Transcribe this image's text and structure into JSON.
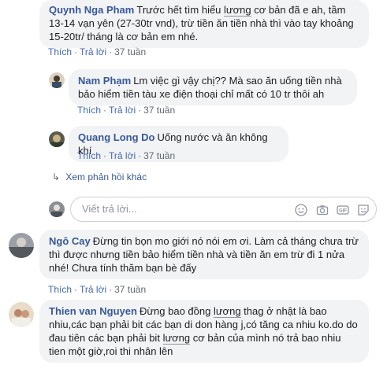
{
  "comments": [
    {
      "author": "Quynh Nga Pham",
      "text_lines": [
        [
          "Trước hết tìm hiểu ",
          {
            "hl": "lương"
          },
          " cơ bản đã e ah, tầm"
        ],
        [
          "13-14 vạn yên (27-30tr vnd), trừ tiền ăn tiền nhà thì vào tay khoảng"
        ],
        [
          "15-20tr/ tháng là cơ bản em nhé."
        ]
      ],
      "like": "Thích",
      "reply": "Trả lời",
      "time": "37 tuần"
    },
    {
      "author": "Nam Phạm",
      "text_lines": [
        [
          "Lm việc gì vậy chị?? Mà sao ăn uống tiền nhà"
        ],
        [
          "bảo hiểm tiền tàu xe điện thoại chỉ mất có 10 tr thôi ah"
        ]
      ],
      "like": "Thích",
      "reply": "Trả lời",
      "time": "37 tuần"
    },
    {
      "author": "Quang Long Do",
      "text_lines": [
        [
          "Uống nước và ăn không khí"
        ]
      ],
      "like": "Thích",
      "reply": "Trả lời",
      "time": "37 tuần"
    },
    {
      "author": "Ngô Cay",
      "text_lines": [
        [
          "Đừng tin bọn mo giới nó nói em ơi. Làm cả tháng chưa trừ"
        ],
        [
          "thì được nhưng tiền bảo hiểm tiền nhà và tiền ăn em trừ đi 1 nửa"
        ],
        [
          "nhé! Chưa tính thăm bạn bè đấy"
        ]
      ],
      "like": "Thích",
      "reply": "Trả lời",
      "time": "37 tuần"
    },
    {
      "author": "Thien van Nguyen",
      "text_lines": [
        [
          "Đừng bao đồng ",
          {
            "hl": "lương"
          },
          " thag ở nhật là bao"
        ],
        [
          "nhiu,các bạn phải bit các bạn di don hàng j,có tăng ca nhiu ko.do do"
        ],
        [
          "đau tiên các bạn phải bit ",
          {
            "hl": "lương"
          },
          " cơ bản của mình nó trả bao nhiu"
        ],
        [
          "tien một giờ,roi thi nhân lên"
        ]
      ]
    }
  ],
  "more_replies": "Xem phản hồi khác",
  "reply_placeholder": "Viết trả lời..."
}
